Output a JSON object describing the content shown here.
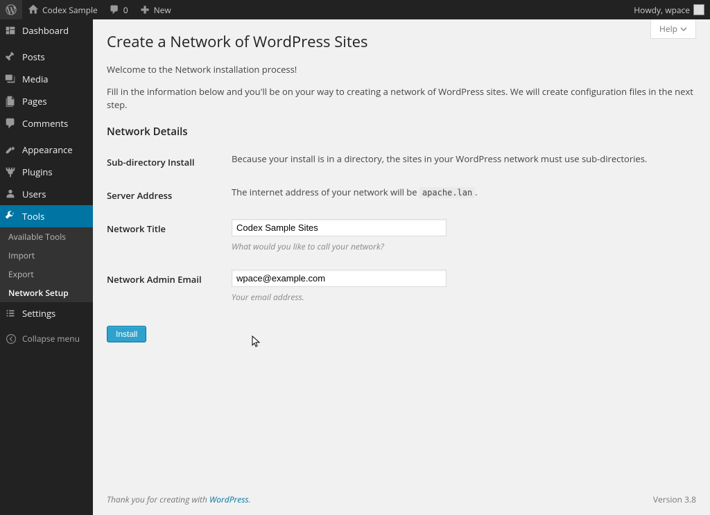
{
  "adminbar": {
    "site_name": "Codex Sample",
    "comments": "0",
    "new_label": "New",
    "howdy_prefix": "Howdy, ",
    "username": "wpace"
  },
  "sidebar": {
    "items": [
      {
        "label": "Dashboard",
        "icon": "dashboard"
      },
      {
        "label": "Posts",
        "icon": "pin"
      },
      {
        "label": "Media",
        "icon": "media"
      },
      {
        "label": "Pages",
        "icon": "pages"
      },
      {
        "label": "Comments",
        "icon": "comments"
      },
      {
        "label": "Appearance",
        "icon": "appearance"
      },
      {
        "label": "Plugins",
        "icon": "plugins"
      },
      {
        "label": "Users",
        "icon": "users"
      },
      {
        "label": "Tools",
        "icon": "tools"
      },
      {
        "label": "Settings",
        "icon": "settings"
      }
    ],
    "tools_submenu": [
      {
        "label": "Available Tools"
      },
      {
        "label": "Import"
      },
      {
        "label": "Export"
      },
      {
        "label": "Network Setup"
      }
    ],
    "collapse": "Collapse menu"
  },
  "content": {
    "help": "Help",
    "title": "Create a Network of WordPress Sites",
    "intro1": "Welcome to the Network installation process!",
    "intro2": "Fill in the information below and you'll be on your way to creating a network of WordPress sites. We will create configuration files in the next step.",
    "section_heading": "Network Details",
    "rows": {
      "subdir": {
        "label": "Sub-directory Install",
        "text": "Because your install is in a directory, the sites in your WordPress network must use sub-directories."
      },
      "server": {
        "label": "Server Address",
        "text_before": "The internet address of your network will be ",
        "code": "apache.lan",
        "text_after": "."
      },
      "net_title": {
        "label": "Network Title",
        "value": "Codex Sample Sites",
        "desc": "What would you like to call your network?"
      },
      "admin_email": {
        "label": "Network Admin Email",
        "value": "wpace@example.com",
        "desc": "Your email address."
      }
    },
    "submit": "Install"
  },
  "footer": {
    "thanks_prefix": "Thank you for creating with ",
    "wp": "WordPress",
    "thanks_suffix": ".",
    "version": "Version 3.8"
  }
}
